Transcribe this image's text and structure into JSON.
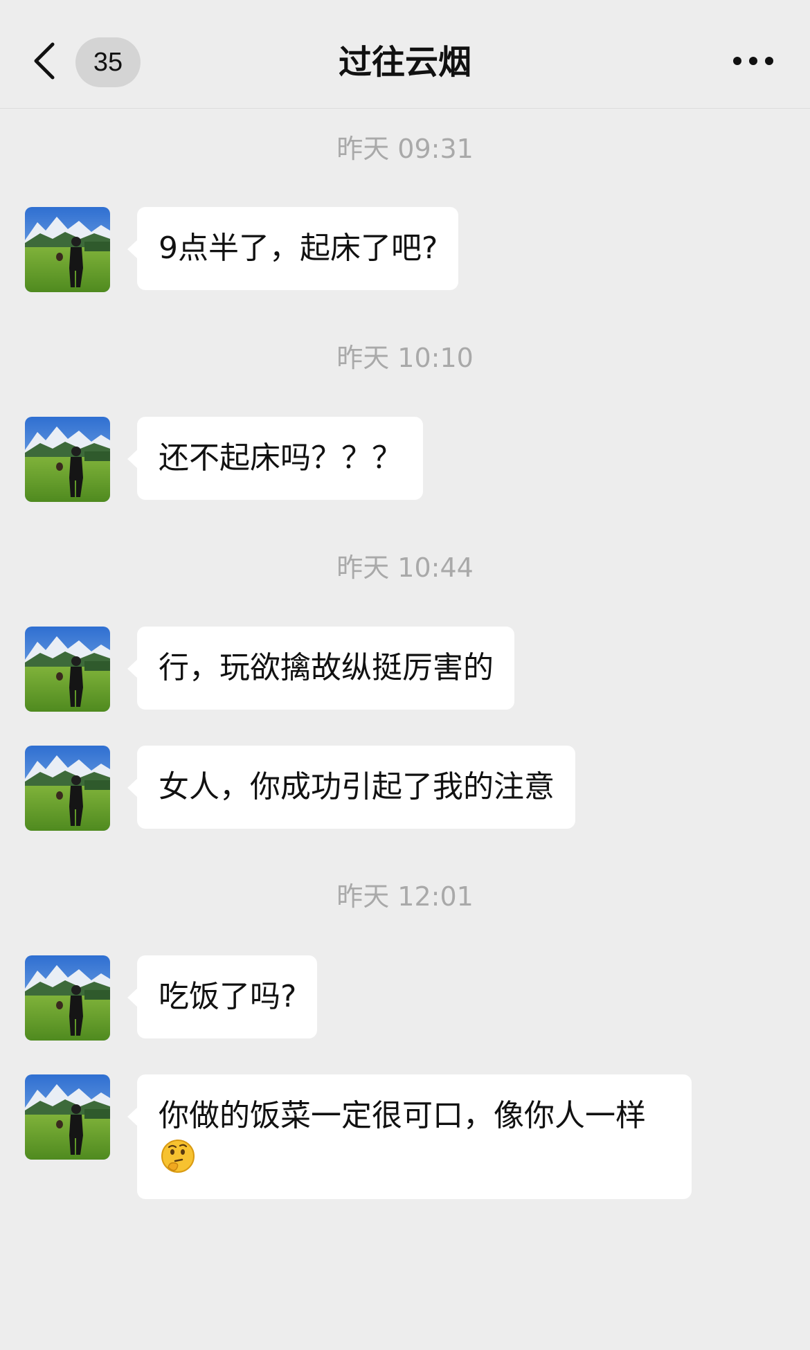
{
  "header": {
    "unread_count": "35",
    "title": "过往云烟",
    "back_icon": "chevron-left-icon",
    "more_icon": "ellipsis-icon"
  },
  "messages": [
    {
      "timestamp": "昨天 09:31",
      "text": "9点半了，起床了吧?"
    },
    {
      "timestamp": "昨天 10:10",
      "text": "还不起床吗？？？"
    },
    {
      "timestamp": "昨天 10:44",
      "text": "行，玩欲擒故纵挺厉害的"
    },
    {
      "text": "女人，你成功引起了我的注意"
    },
    {
      "timestamp": "昨天 12:01",
      "text": "吃饭了吗?"
    },
    {
      "text": "你做的饭菜一定很可口，像你人一样",
      "emoji": "thinking-face-emoji"
    }
  ],
  "colors": {
    "background": "#ededed",
    "bubble": "#ffffff",
    "timestamp": "#a9a9a9",
    "badge": "#d4d4d4"
  }
}
